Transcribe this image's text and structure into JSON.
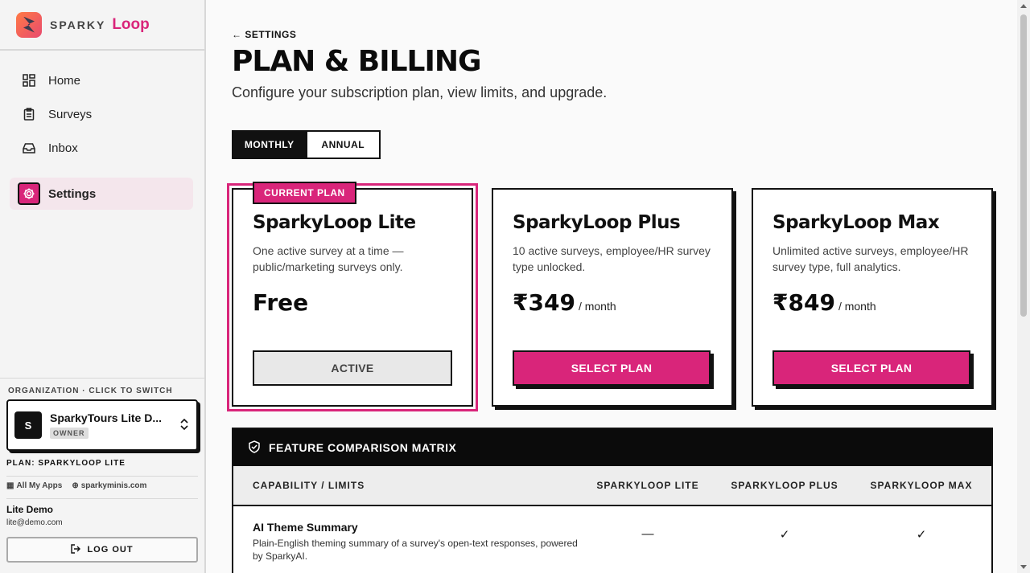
{
  "brand": {
    "name_part1": "SPARKY",
    "name_part2": "Loop"
  },
  "sidebar": {
    "items": [
      {
        "label": "Home",
        "icon": "grid-icon"
      },
      {
        "label": "Surveys",
        "icon": "clipboard-icon"
      },
      {
        "label": "Inbox",
        "icon": "inbox-icon"
      },
      {
        "label": "Settings",
        "icon": "gear-icon"
      }
    ],
    "org_label": "ORGANIZATION · CLICK TO SWITCH",
    "org": {
      "avatar": "S",
      "name": "SparkyTours Lite D...",
      "role": "OWNER"
    },
    "plan_line": "PLAN: SPARKYLOOP LITE",
    "links": {
      "apps": "All My Apps",
      "site": "sparkyminis.com"
    },
    "user": {
      "name": "Lite Demo",
      "email": "lite@demo.com"
    },
    "logout": "LOG OUT"
  },
  "main": {
    "back": "SETTINGS",
    "title": "PLAN & BILLING",
    "subtitle": "Configure your subscription plan, view limits, and upgrade.",
    "billing_toggle": {
      "monthly": "MONTHLY",
      "annual": "ANNUAL",
      "selected": "MONTHLY"
    },
    "plans": [
      {
        "badge": "CURRENT PLAN",
        "name": "SparkyLoop Lite",
        "desc": "One active survey at a time — public/marketing surveys only.",
        "price": "Free",
        "per": "",
        "button": "ACTIVE"
      },
      {
        "name": "SparkyLoop Plus",
        "desc": "10 active surveys, employee/HR survey type unlocked.",
        "price": "₹349",
        "per": "/ month",
        "button": "SELECT PLAN"
      },
      {
        "name": "SparkyLoop Max",
        "desc": "Unlimited active surveys, employee/HR survey type, full analytics.",
        "price": "₹849",
        "per": "/ month",
        "button": "SELECT PLAN"
      }
    ],
    "matrix": {
      "title": "FEATURE COMPARISON MATRIX",
      "columns": [
        "CAPABILITY / LIMITS",
        "SPARKYLOOP LITE",
        "SPARKYLOOP PLUS",
        "SPARKYLOOP MAX"
      ],
      "rows": [
        {
          "name": "AI Theme Summary",
          "desc": "Plain-English theming summary of a survey's open-text responses, powered by SparkyAI.",
          "lite": "—",
          "plus": "✓",
          "max": "✓"
        }
      ]
    }
  },
  "colors": {
    "accent": "#d9257a",
    "ink": "#111111"
  }
}
